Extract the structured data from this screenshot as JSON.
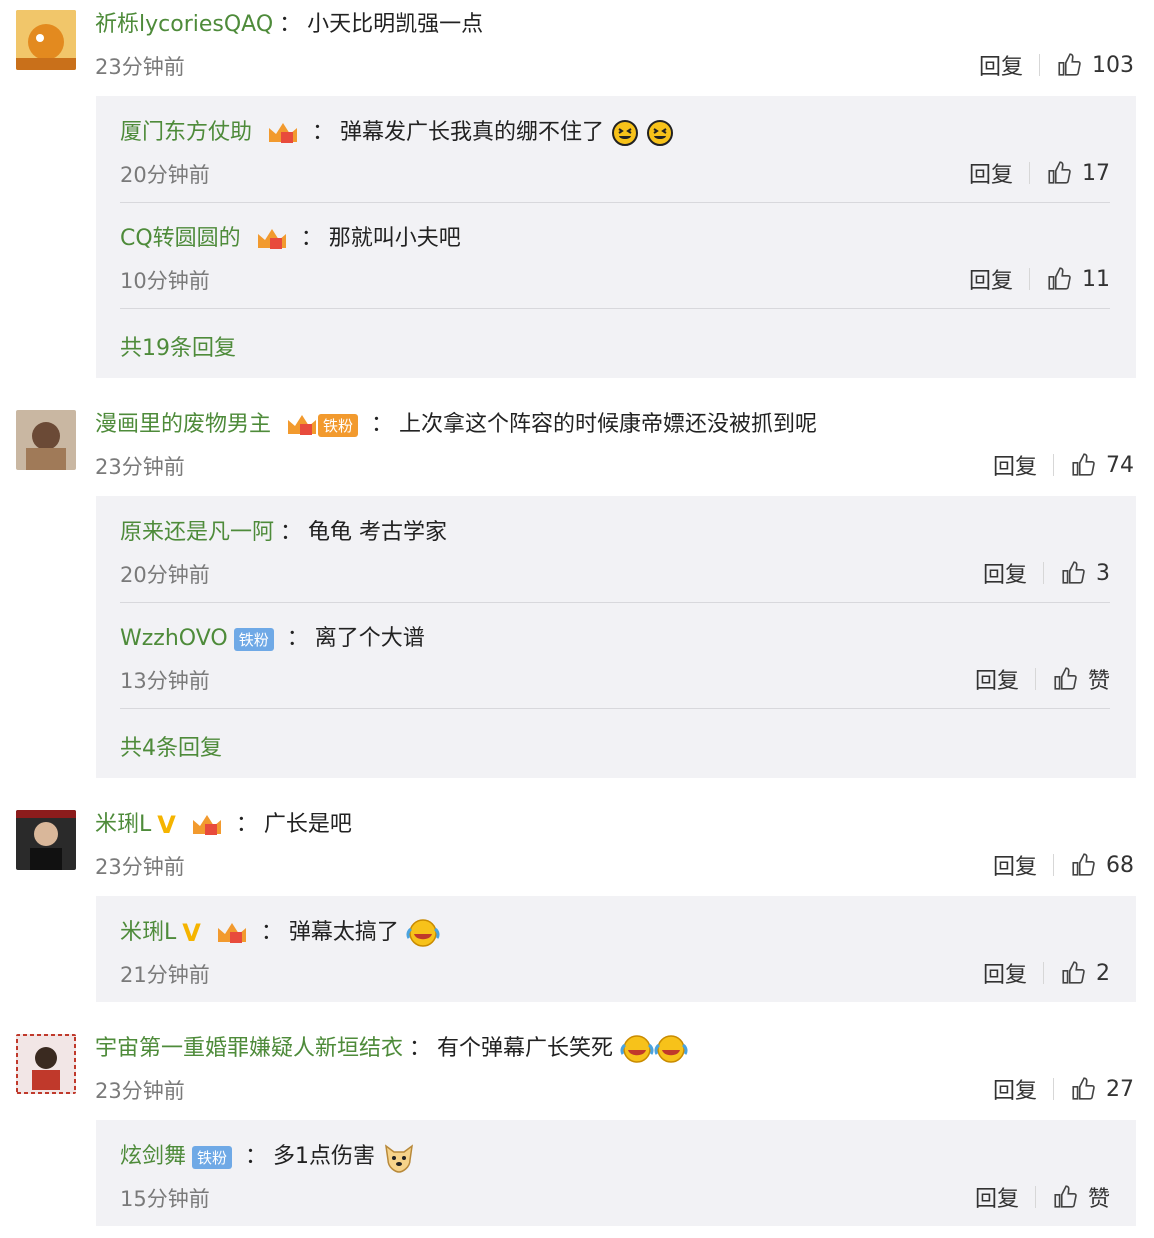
{
  "labels": {
    "reply": "回复",
    "colon": "："
  },
  "comments": [
    {
      "user": "祈栎lycoriesQAQ",
      "text": "小天比明凯强一点",
      "time": "23分钟前",
      "likes": "103",
      "replies": [
        {
          "user": "厦门东方仗助",
          "text": "弹幕发广长我真的绷不住了",
          "time": "20分钟前",
          "likes": "17"
        },
        {
          "user": "CQ转圆圆的",
          "text": "那就叫小夫吧",
          "time": "10分钟前",
          "likes": "11"
        }
      ],
      "more": "共19条回复"
    },
    {
      "user": "漫画里的废物男主",
      "badge": "铁粉",
      "text": "上次拿这个阵容的时候康帝嫖还没被抓到呢",
      "time": "23分钟前",
      "likes": "74",
      "replies": [
        {
          "user": "原来还是凡一阿",
          "text": "龟龟 考古学家",
          "time": "20分钟前",
          "likes": "3"
        },
        {
          "user": "WzzhOVO",
          "badge": "铁粉",
          "text": "离了个大谱",
          "time": "13分钟前",
          "likes": "赞"
        }
      ],
      "more": "共4条回复"
    },
    {
      "user": "米琍L",
      "text": "广长是吧",
      "time": "23分钟前",
      "likes": "68",
      "replies": [
        {
          "user": "米琍L",
          "text": "弹幕太搞了",
          "time": "21分钟前",
          "likes": "2"
        }
      ]
    },
    {
      "user": "宇宙第一重婚罪嫌疑人新垣结衣",
      "text": "有个弹幕广长笑死",
      "time": "23分钟前",
      "likes": "27",
      "replies": [
        {
          "user": "炫剑舞",
          "badge": "铁粉",
          "text": "多1点伤害",
          "time": "15分钟前",
          "likes": "赞"
        }
      ]
    }
  ]
}
